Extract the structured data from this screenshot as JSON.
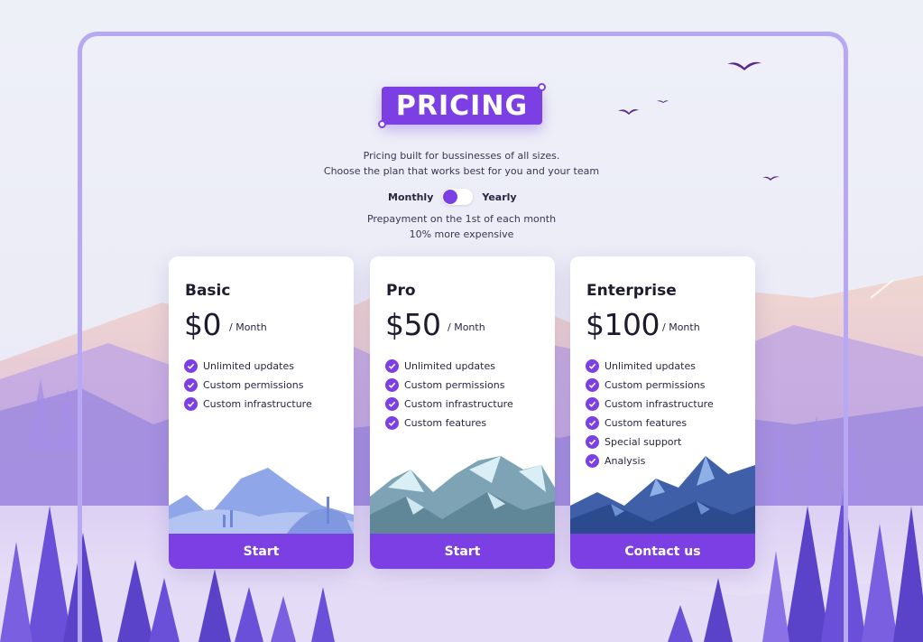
{
  "header": {
    "title": "PRICING",
    "subtitle_line1": "Pricing built for bussinesses of all sizes.",
    "subtitle_line2": "Choose the plan that works best for you and your team"
  },
  "billing_toggle": {
    "left_label": "Monthly",
    "right_label": "Yearly",
    "selected": "Monthly",
    "note_line1": "Prepayment on the 1st of each month",
    "note_line2": "10% more expensive"
  },
  "plans": [
    {
      "name": "Basic",
      "price": "$0",
      "period": "/ Month",
      "features": [
        "Unlimited updates",
        "Custom permissions",
        "Custom infrastructure"
      ],
      "cta": "Start"
    },
    {
      "name": "Pro",
      "price": "$50",
      "period": "/ Month",
      "features": [
        "Unlimited updates",
        "Custom permissions",
        "Custom infrastructure",
        "Custom features"
      ],
      "cta": "Start"
    },
    {
      "name": "Enterprise",
      "price": "$100",
      "period": "/ Month",
      "features": [
        "Unlimited updates",
        "Custom permissions",
        "Custom infrastructure",
        "Custom features",
        "Special support",
        "Analysis"
      ],
      "cta": "Contact us"
    }
  ],
  "colors": {
    "accent": "#7b3fe4",
    "frame": "#b7a8f4",
    "background": "#eceef7"
  },
  "icons": [
    "check-icon",
    "bird-icon"
  ]
}
